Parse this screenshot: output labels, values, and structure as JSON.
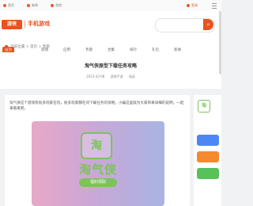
{
  "topbar": {
    "links": [
      "首页",
      "新闻",
      "游戏"
    ],
    "user": "登录"
  },
  "header": {
    "logo": "游侠",
    "logo_text": "手机游戏"
  },
  "nav": {
    "items": [
      "首页",
      "游戏",
      "应用",
      "专题",
      "合集",
      "排行",
      "礼包",
      "新闻"
    ],
    "active_index": 0
  },
  "breadcrumb": [
    "当前位置",
    "首页",
    "专题"
  ],
  "article": {
    "title": "淘气侠原型下载任务攻略",
    "meta": [
      "2023-03-08",
      "游侠手游",
      "阅读"
    ],
    "intro": "淘气侠这个游戏有很多玩家在玩，很多玩家都在问下载任务的攻略，小编这里就为大家带来详细的说明，一起来看看吧。",
    "hero": {
      "logo_text": "淘",
      "name": "淘气侠",
      "tag": "福利领取"
    }
  },
  "sidebar": {
    "logo_text": "淘"
  }
}
